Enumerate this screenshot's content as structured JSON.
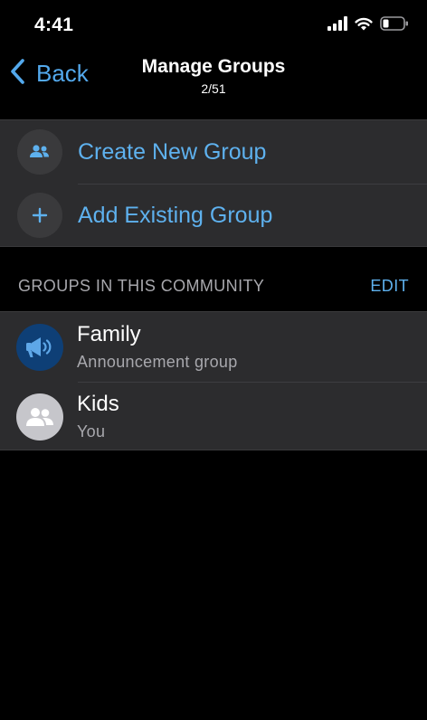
{
  "status_bar": {
    "time": "4:41",
    "icons": [
      "signal-icon",
      "wifi-icon",
      "battery-icon"
    ]
  },
  "nav": {
    "back_label": "Back",
    "title": "Manage Groups",
    "subtitle": "2/51"
  },
  "actions": [
    {
      "label": "Create New Group",
      "icon": "people-icon"
    },
    {
      "label": "Add Existing Group",
      "icon": "plus-icon"
    }
  ],
  "section": {
    "title": "GROUPS IN THIS COMMUNITY",
    "edit_label": "EDIT"
  },
  "groups": [
    {
      "name": "Family",
      "subtitle": "Announcement group",
      "icon": "megaphone-icon"
    },
    {
      "name": "Kids",
      "subtitle": "You",
      "icon": "group-avatar-icon"
    }
  ],
  "colors": {
    "accent": "#5eb1ee",
    "background": "#000000",
    "cell": "#2c2c2e",
    "secondary_text": "#a8a8ad",
    "announcement_avatar": "#0e3f76"
  }
}
